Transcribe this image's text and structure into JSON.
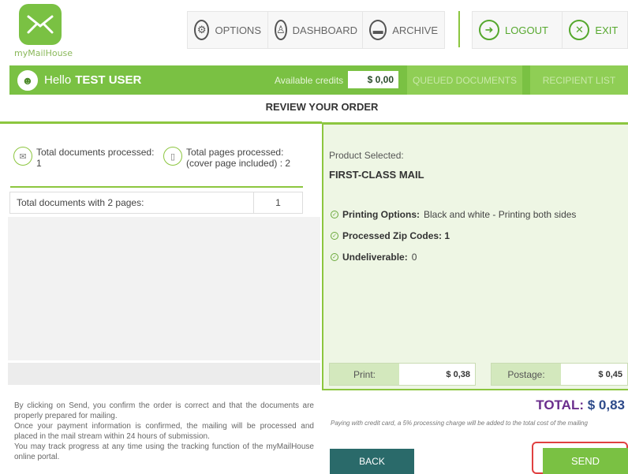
{
  "app": {
    "logo_text": "myMailHouse"
  },
  "nav": {
    "options": "OPTIONS",
    "dashboard": "DASHBOARD",
    "archive": "ARCHIVE",
    "logout": "LOGOUT",
    "exit": "EXIT"
  },
  "bar": {
    "hello": "Hello",
    "user": "TEST USER",
    "credits_label": "Available credits",
    "credits_value": "$ 0,00",
    "tab_queued": "QUEUED DOCUMENTS",
    "tab_recipients": "RECIPIENT LIST"
  },
  "page_title": "REVIEW YOUR ORDER",
  "left": {
    "docs_label": "Total documents processed:",
    "docs_value": "1",
    "pages_label": "Total pages processed:",
    "pages_sub": "(cover page included) : 2",
    "table": [
      {
        "label": "Total documents with 2 pages:",
        "value": "1"
      }
    ],
    "disclaimer": [
      "By clicking on Send, you confirm the order is correct and that the documents are properly prepared for mailing.",
      "Once your payment information is confirmed, the mailing will be processed and placed in the mail stream within 24 hours of submission.",
      "You may track progress at any time using the tracking function of the myMailHouse online portal."
    ]
  },
  "right": {
    "product_label": "Product Selected:",
    "product_value": "FIRST-CLASS MAIL",
    "options": [
      {
        "label": "Printing Options:",
        "value": "Black and white - Printing both sides"
      },
      {
        "label": "Processed Zip Codes: 1",
        "value": ""
      },
      {
        "label": "Undeliverable:",
        "value": "0"
      }
    ],
    "print_label": "Print:",
    "print_value": "$ 0,38",
    "postage_label": "Postage:",
    "postage_value": "$ 0,45",
    "total_label": "TOTAL:",
    "total_value": "$ 0,83",
    "note": "Paying with credit card, a 5% processing charge will be added to the total cost of the mailing"
  },
  "actions": {
    "back": "BACK",
    "send": "SEND"
  },
  "colors": {
    "accent": "#7ac143",
    "back": "#2a6a6a",
    "highlight": "#e04040",
    "total": "#2d4a8a"
  }
}
